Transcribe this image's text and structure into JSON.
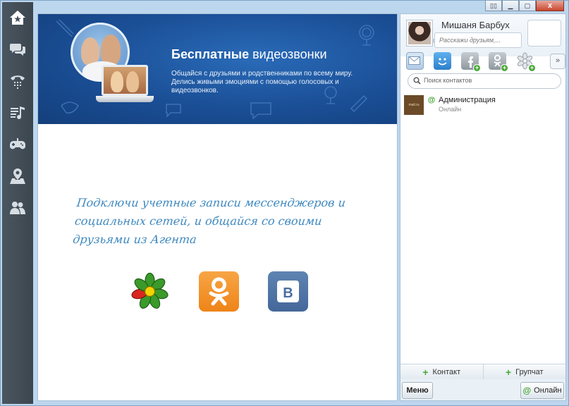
{
  "window": {
    "controls": [
      "layout-icon",
      "minimize-icon",
      "maximize-icon",
      "close-icon"
    ],
    "close_label": "x"
  },
  "sidebar": {
    "items": [
      {
        "name": "home-star-icon"
      },
      {
        "name": "chat-icon"
      },
      {
        "name": "phone-icon"
      },
      {
        "name": "music-icon"
      },
      {
        "name": "games-icon"
      },
      {
        "name": "location-icon"
      },
      {
        "name": "people-icon"
      }
    ]
  },
  "banner": {
    "title_bold": "Бесплатные",
    "title_rest": " видеозвонки",
    "subtitle": "Общайся с друзьями и родственниками по всему миру. Делись живыми эмоциями с помощью голосовых и видеозвонков."
  },
  "main": {
    "invite_text": "Подключи учетные записи мессенджеров и социальных сетей, и общайся со своими друзьями из Агента",
    "socials": [
      "icq-icon",
      "odnoklassniki-icon",
      "vkontakte-icon"
    ]
  },
  "profile": {
    "name": "Мишаня Барбух",
    "status_placeholder": "Расскажи друзьям,..."
  },
  "services": [
    "mail-icon",
    "my-world-icon",
    "facebook-add-icon",
    "odnoklassniki-add-icon",
    "icq-add-icon"
  ],
  "more_label": "»",
  "search": {
    "placeholder": "Поиск контактов"
  },
  "contacts": [
    {
      "name": "Администрация",
      "status": "Онлайн",
      "avatar_text": "mail.ru"
    }
  ],
  "bottom_bar": {
    "add_contact": "Контакт",
    "add_group": "Групчат"
  },
  "footer": {
    "menu": "Меню",
    "status": "Онлайн"
  },
  "colors": {
    "accent": "#3d88bf",
    "online": "#3aa52e",
    "sidebar": "#434e58"
  }
}
